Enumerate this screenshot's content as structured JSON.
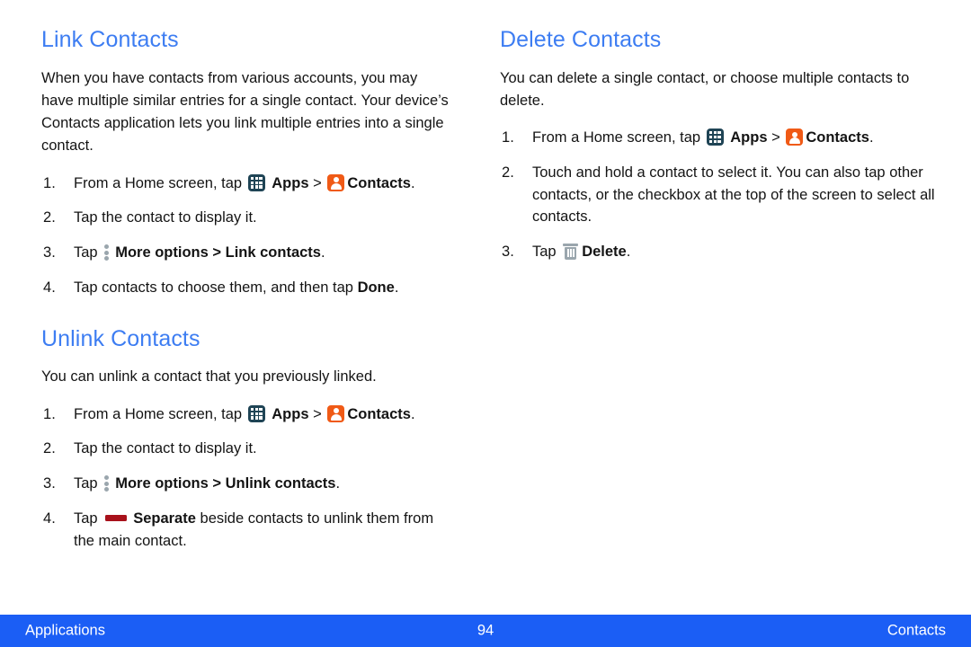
{
  "page": {
    "number": "94",
    "footer_left": "Applications",
    "footer_right": "Contacts",
    "heading_color": "#3d7df2",
    "footer_color": "#1b5ef5"
  },
  "icons": {
    "apps": {
      "name": "apps-icon",
      "color": "#1f4455"
    },
    "contacts": {
      "name": "contacts-icon",
      "color": "#f05a16"
    },
    "more_options": {
      "name": "more-options-icon",
      "color": "#9aa6ad"
    },
    "separate": {
      "name": "separate-icon",
      "color": "#a8111b"
    },
    "delete": {
      "name": "delete-icon",
      "color": "#9aa6ad"
    }
  },
  "left_column": {
    "link_contacts": {
      "heading": "Link Contacts",
      "intro": "When you have contacts from various accounts, you may have multiple similar entries for a single contact. Your device’s Contacts application lets you link multiple entries into a single contact.",
      "steps": {
        "s1_pre": "From a Home screen, tap",
        "s1_apps": "Apps",
        "s1_sep": ">",
        "s1_contacts": "Contacts",
        "s1_end": ".",
        "s2": "Tap the contact to display it.",
        "s3_pre": "Tap",
        "s3_more": "More options",
        "s3_sep": ">",
        "s3_target": "Link contacts",
        "s3_end": ".",
        "s4_pre": "Tap contacts to choose them, and then tap",
        "s4_bold": "Done",
        "s4_end": "."
      }
    },
    "unlink_contacts": {
      "heading": "Unlink Contacts",
      "intro": "You can unlink a contact that you previously linked.",
      "steps": {
        "s1_pre": "From a Home screen, tap",
        "s1_apps": "Apps",
        "s1_sep": ">",
        "s1_contacts": "Contacts",
        "s1_end": ".",
        "s2": "Tap the contact to display it.",
        "s3_pre": "Tap",
        "s3_more": "More options",
        "s3_sep": ">",
        "s3_target": "Unlink contacts",
        "s3_end": ".",
        "s4_pre": "Tap",
        "s4_bold": "Separate",
        "s4_post": "beside contacts to unlink them from the main contact."
      }
    }
  },
  "right_column": {
    "delete_contacts": {
      "heading": "Delete Contacts",
      "intro": "You can delete a single contact, or choose multiple contacts to delete.",
      "steps": {
        "s1_pre": "From a Home screen, tap",
        "s1_apps": "Apps",
        "s1_sep": ">",
        "s1_contacts": "Contacts",
        "s1_end": ".",
        "s2": "Touch and hold a contact to select it. You can also tap other contacts, or the checkbox at the top of the screen to select all contacts.",
        "s3_pre": "Tap",
        "s3_bold": "Delete",
        "s3_end": "."
      }
    }
  }
}
